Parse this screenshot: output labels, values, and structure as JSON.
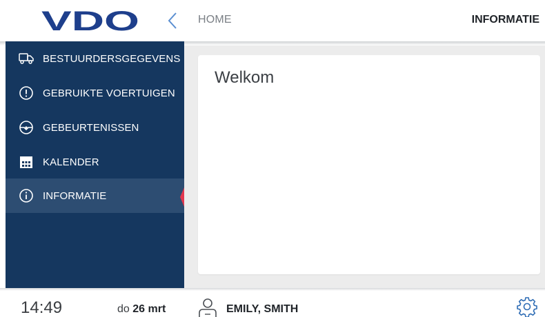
{
  "header": {
    "logo_text": "VDO",
    "breadcrumb": "HOME",
    "page_title": "INFORMATIE"
  },
  "sidebar": {
    "items": [
      {
        "label": "BESTUURDERSGEGEVENS",
        "icon": "truck-icon",
        "active": false
      },
      {
        "label": "GEBRUIKTE VOERTUIGEN",
        "icon": "warning-circle-icon",
        "active": false
      },
      {
        "label": "GEBEURTENISSEN",
        "icon": "steering-wheel-icon",
        "active": false
      },
      {
        "label": "KALENDER",
        "icon": "calendar-icon",
        "active": false
      },
      {
        "label": "INFORMATIE",
        "icon": "info-circle-icon",
        "active": true
      }
    ]
  },
  "main": {
    "welcome_text": "Welkom"
  },
  "footer": {
    "time": "14:49",
    "day_abbr": "do",
    "date": "26 mrt",
    "user_name": "EMILY, SMITH",
    "settings_icon": "gear-icon"
  },
  "colors": {
    "sidebar_bg": "#15375f",
    "sidebar_active_bg": "#2d4d72",
    "logo_blue": "#1e3f8c",
    "active_marker": "#e2374f",
    "accent_icon_blue": "#2f6db5"
  }
}
